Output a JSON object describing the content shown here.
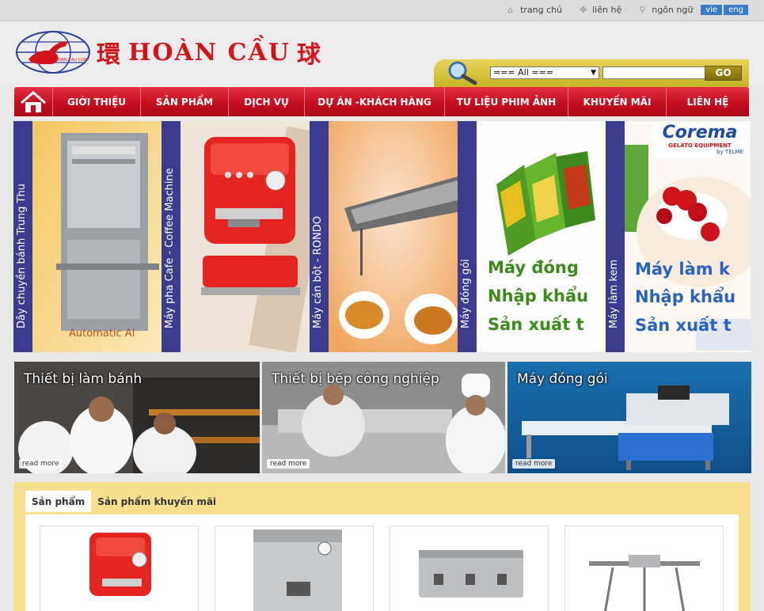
{
  "topbar": {
    "links": [
      {
        "label": "trang chủ",
        "icon": "home-icon"
      },
      {
        "label": "liên hệ",
        "icon": "contact-icon"
      },
      {
        "label": "ngôn ngữ",
        "icon": "search-icon"
      }
    ],
    "languages": [
      "vie",
      "eng"
    ]
  },
  "header": {
    "logo_text": "HOÀN CẦU",
    "logo_sub": "HOAN CAU CORP",
    "logo_char_left": "環",
    "logo_char_right": "球"
  },
  "search": {
    "category_value": "=== All ===",
    "button_label": "GO"
  },
  "nav": {
    "items": [
      "GIỚI THIỆU",
      "SẢN PHẨM",
      "DỊCH VỤ",
      "DỰ ÁN -KHÁCH HÀNG",
      "TƯ LIỆU PHIM ẢNH",
      "KHUYẾN MÃI",
      "LIÊN HỆ"
    ]
  },
  "banners": [
    {
      "label": "Dây chuyền bánh Trung Thu",
      "caption": "Automatic Al"
    },
    {
      "label": "Máy pha Cafe - Coffee Machine",
      "caption": ""
    },
    {
      "label": "Máy cán bột - RONDO",
      "caption": ""
    },
    {
      "label": "Máy đóng gói",
      "caption_lines": [
        "Máy đóng",
        "Nhập khẩu",
        "Sản xuất t"
      ]
    },
    {
      "label": "Máy làm kem",
      "caption_lines": [
        "Máy làm k",
        "Nhập khẩu",
        "Sản xuất t"
      ],
      "brand": "Corema",
      "brand_sub": "GELATO EQUIPMENT",
      "brand_by": "by TELME"
    }
  ],
  "promos": [
    {
      "title": "Thiết bị làm bánh",
      "readmore": "read more"
    },
    {
      "title": "Thiết bị bếp công nghiệp",
      "readmore": "read more"
    },
    {
      "title": "Máy đóng gói",
      "readmore": "read more"
    }
  ],
  "products": {
    "tabs": [
      "Sản phẩm",
      "Sản phẩm khuyến mãi"
    ]
  },
  "colors": {
    "nav_red": "#c60e1f",
    "band_blue": "#3b3c8f",
    "gold": "#d6c23a",
    "caption_green": "#3d8a1c",
    "caption_blue": "#2a62c2"
  }
}
